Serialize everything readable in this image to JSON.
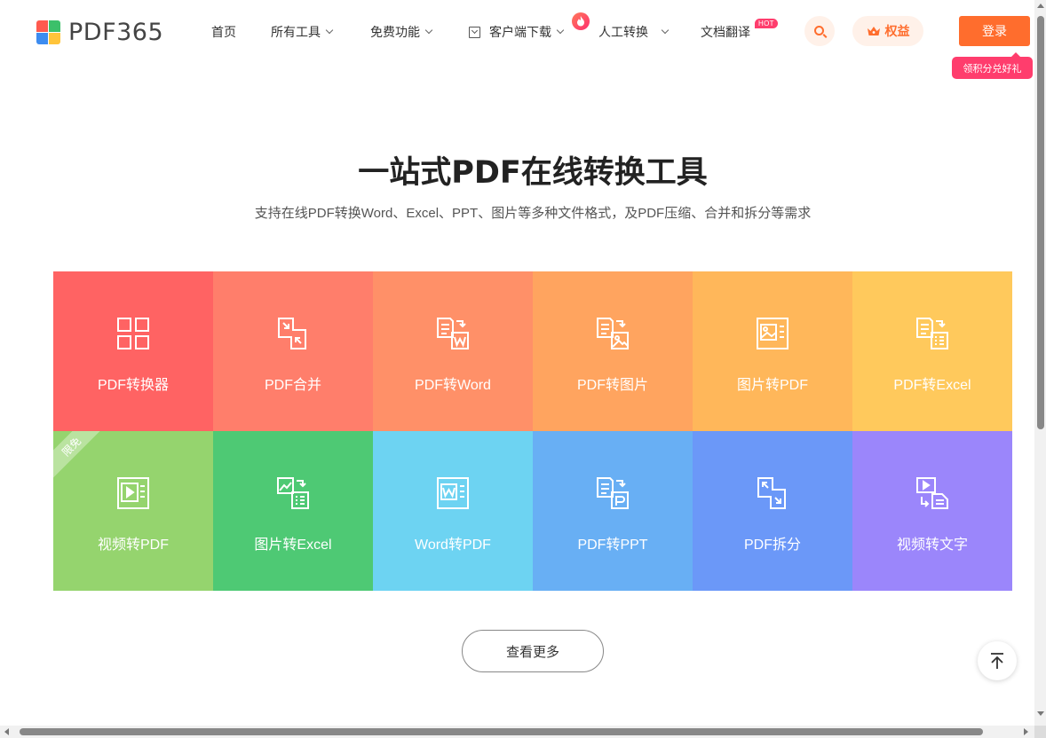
{
  "header": {
    "logo_text": "PDF365",
    "nav": [
      {
        "label": "首页"
      },
      {
        "label": "所有工具"
      },
      {
        "label": "免费功能"
      },
      {
        "label": "客户端下载"
      },
      {
        "label": "人工转换"
      },
      {
        "label": "文档翻译"
      }
    ],
    "hot_badge": "HOT",
    "benefit_label": "权益",
    "login_label": "登录",
    "gift_tip": "领积分兑好礼",
    "accent_color": "#ff6d2d"
  },
  "hero": {
    "title": "一站式PDF在线转换工具",
    "subtitle": "支持在线PDF转换Word、Excel、PPT、图片等多种文件格式，及PDF压缩、合并和拆分等需求"
  },
  "tools": [
    {
      "label": "PDF转换器",
      "icon": "grid-icon",
      "color": "#ff6363"
    },
    {
      "label": "PDF合并",
      "icon": "merge-icon",
      "color": "#ff7e6b"
    },
    {
      "label": "PDF转Word",
      "icon": "pdf-to-word-icon",
      "color": "#ff9068"
    },
    {
      "label": "PDF转图片",
      "icon": "pdf-to-image-icon",
      "color": "#ffa45f"
    },
    {
      "label": "图片转PDF",
      "icon": "image-to-pdf-icon",
      "color": "#ffb75a"
    },
    {
      "label": "PDF转Excel",
      "icon": "pdf-to-excel-icon",
      "color": "#ffc95c"
    },
    {
      "label": "视频转PDF",
      "icon": "video-to-pdf-icon",
      "color": "#95d46e",
      "ribbon": "限免"
    },
    {
      "label": "图片转Excel",
      "icon": "image-to-excel-icon",
      "color": "#4ec974"
    },
    {
      "label": "Word转PDF",
      "icon": "word-to-pdf-icon",
      "color": "#6dd3f2"
    },
    {
      "label": "PDF转PPT",
      "icon": "pdf-to-ppt-icon",
      "color": "#68aff4"
    },
    {
      "label": "PDF拆分",
      "icon": "split-icon",
      "color": "#6b98f8"
    },
    {
      "label": "视频转文字",
      "icon": "video-to-text-icon",
      "color": "#9b86fb"
    }
  ],
  "more_label": "查看更多"
}
